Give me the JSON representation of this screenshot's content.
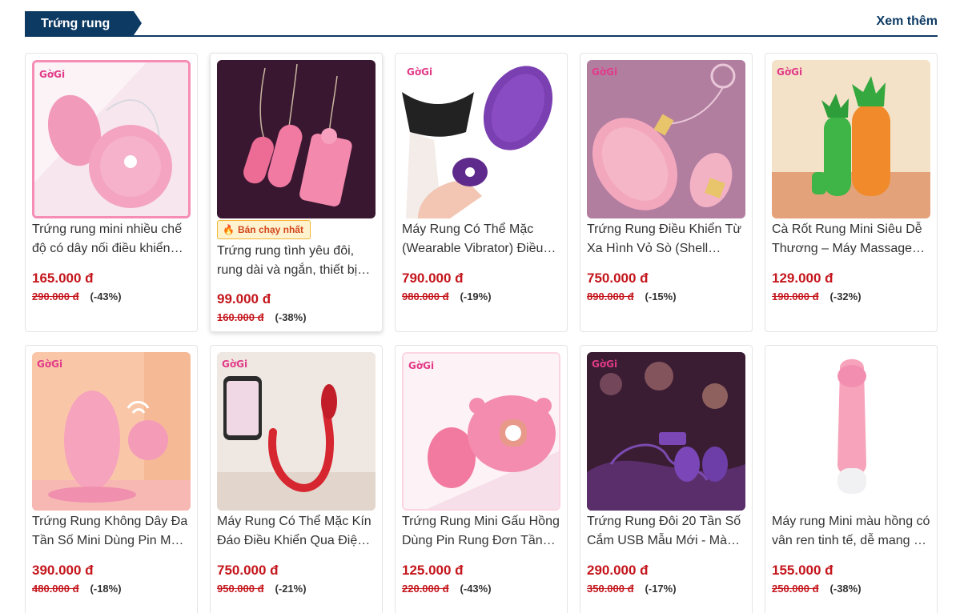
{
  "section": {
    "title": "Trứng rung",
    "see_more": "Xem thêm"
  },
  "badge": {
    "label": "Bán chạy nhất",
    "icon": "fire-icon"
  },
  "brand": "GờGi",
  "colors": {
    "header": "#0d3a63",
    "price": "#c4161c",
    "badge_bg": "#fff3cf"
  },
  "products": [
    {
      "title": "Trứng rung mini nhiều chế độ có dây nối điều khiển…",
      "price": "165.000 đ",
      "old_price": "290.000 đ",
      "discount": "(-43%)"
    },
    {
      "title": "Trứng rung tình yêu đôi, rung dài và ngắn, thiết bị…",
      "price": "99.000 đ",
      "old_price": "160.000 đ",
      "discount": "(-38%)"
    },
    {
      "title": "Máy Rung Có Thể Mặc (Wearable Vibrator) Điều…",
      "price": "790.000 đ",
      "old_price": "980.000 đ",
      "discount": "(-19%)"
    },
    {
      "title": "Trứng Rung Điều Khiển Từ Xa Hình Vỏ Sò (Shell…",
      "price": "750.000 đ",
      "old_price": "890.000 đ",
      "discount": "(-15%)"
    },
    {
      "title": "Cà Rốt Rung Mini Siêu Dễ Thương – Máy Massage…",
      "price": "129.000 đ",
      "old_price": "190.000 đ",
      "discount": "(-32%)"
    },
    {
      "title": "Trứng Rung Không Dây Đa Tần Số Mini Dùng Pin M…",
      "price": "390.000 đ",
      "old_price": "480.000 đ",
      "discount": "(-18%)"
    },
    {
      "title": "Máy Rung Có Thể Mặc Kín Đáo Điều Khiển Qua Điệ…",
      "price": "750.000 đ",
      "old_price": "950.000 đ",
      "discount": "(-21%)"
    },
    {
      "title": "Trứng Rung Mini Gấu Hồng Dùng Pin Rung Đơn Tần…",
      "price": "125.000 đ",
      "old_price": "220.000 đ",
      "discount": "(-43%)"
    },
    {
      "title": "Trứng Rung Đôi 20 Tần Số Cắm USB Mẫu Mới - Mà…",
      "price": "290.000 đ",
      "old_price": "350.000 đ",
      "discount": "(-17%)"
    },
    {
      "title": "Máy rung Mini màu hồng có vân ren tinh tế, dễ mang …",
      "price": "155.000 đ",
      "old_price": "250.000 đ",
      "discount": "(-38%)"
    }
  ]
}
